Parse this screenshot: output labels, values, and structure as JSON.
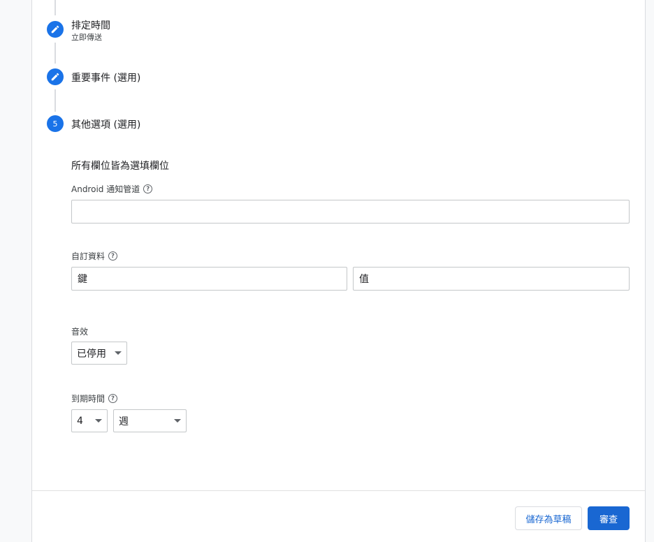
{
  "steps": [
    {
      "title": "排定時間",
      "subtitle": "立即傳送",
      "icon": "edit-icon"
    },
    {
      "title": "重要事件 (選用)",
      "icon": "edit-icon"
    },
    {
      "title": "其他選項 (選用)",
      "number": "5"
    }
  ],
  "options": {
    "heading": "所有欄位皆為選填欄位",
    "android_channel": {
      "label": "Android 通知管道",
      "value": "",
      "help_icon": "help-icon"
    },
    "custom_data": {
      "label": "自訂資料",
      "key_placeholder": "鍵",
      "value_placeholder": "值",
      "help_icon": "help-icon"
    },
    "sound": {
      "label": "音效",
      "selected": "已停用"
    },
    "expiration": {
      "label": "到期時間",
      "amount": "4",
      "unit": "週",
      "help_icon": "help-icon"
    }
  },
  "footer": {
    "save_draft_label": "儲存為草稿",
    "review_label": "審查"
  },
  "colors": {
    "accent": "#1967d2",
    "step_circle": "#1a73e8",
    "border": "#dadce0"
  }
}
